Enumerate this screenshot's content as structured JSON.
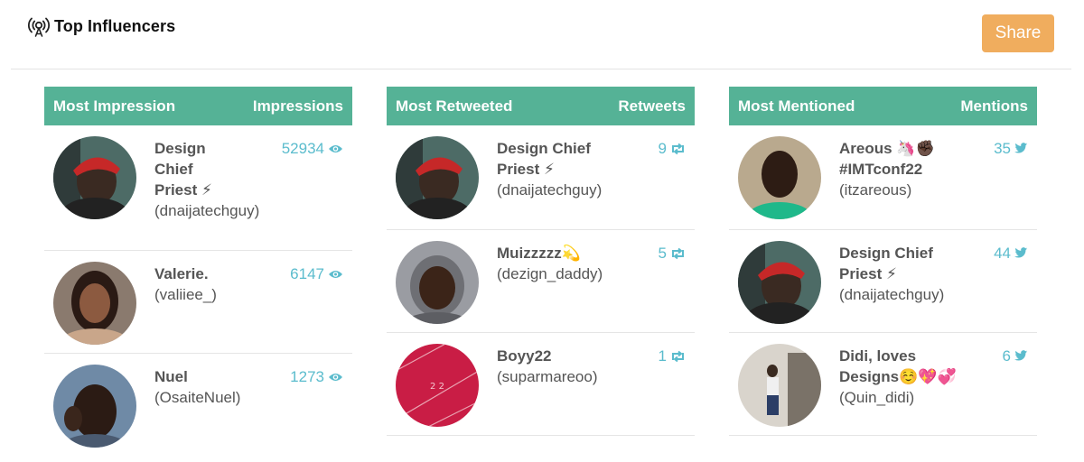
{
  "header": {
    "title": "Top Influencers",
    "share_label": "Share"
  },
  "colors": {
    "table_header": "#55b296",
    "count": "#5bbccd",
    "share": "#f0ad5e"
  },
  "tables": [
    {
      "title": "Most Impression",
      "metric": "Impressions",
      "icon": "eye-icon",
      "rows": [
        {
          "name": "Design Chief Priest ⚡",
          "handle": "(dnaijatechguy)",
          "count": "52934"
        },
        {
          "name": "Valerie.",
          "handle": "(valiiee_)",
          "count": "6147"
        },
        {
          "name": "Nuel",
          "handle": "(OsaiteNuel)",
          "count": "1273"
        }
      ]
    },
    {
      "title": "Most Retweeted",
      "metric": "Retweets",
      "icon": "retweet-icon",
      "rows": [
        {
          "name": "Design Chief Priest ⚡",
          "handle": "(dnaijatechguy)",
          "count": "9"
        },
        {
          "name": "Muizzzzz💫",
          "handle": "(dezign_daddy)",
          "count": "5"
        },
        {
          "name": "Boyy22",
          "handle": "(suparmareoo)",
          "count": "1"
        }
      ]
    },
    {
      "title": "Most Mentioned",
      "metric": "Mentions",
      "icon": "twitter-bird-icon",
      "rows": [
        {
          "name": "Areous 🦄✊🏿 #IMTconf22",
          "handle": "(itzareous)",
          "count": "35"
        },
        {
          "name": "Design Chief Priest ⚡",
          "handle": "(dnaijatechguy)",
          "count": "44"
        },
        {
          "name": "Didi, loves Designs☺️💖💞",
          "handle": "(Quin_didi)",
          "count": "6"
        }
      ]
    }
  ]
}
